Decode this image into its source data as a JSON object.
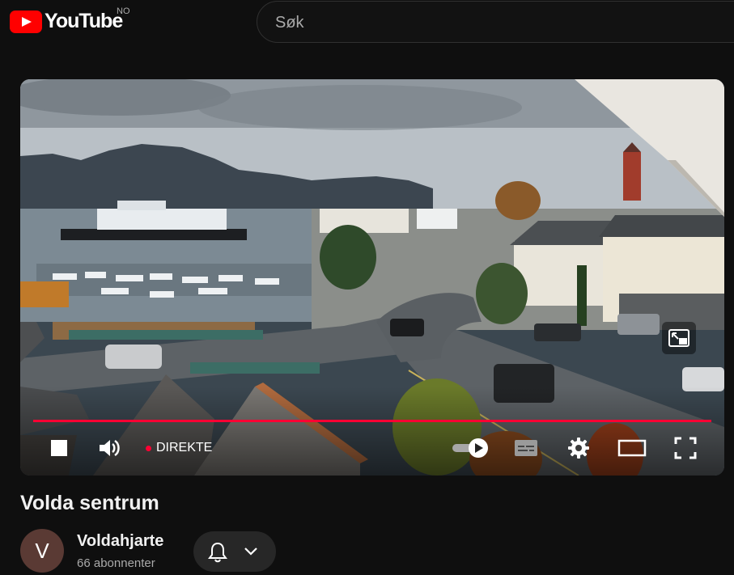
{
  "header": {
    "logo_text": "YouTube",
    "region": "NO",
    "search_placeholder": "Søk"
  },
  "player": {
    "live_label": "DIREKTE",
    "buttons": [
      "stop",
      "volume",
      "autoplay-toggle",
      "subtitles",
      "settings",
      "theater-mode",
      "fullscreen",
      "miniplayer"
    ]
  },
  "video": {
    "title": "Volda sentrum"
  },
  "channel": {
    "avatar_letter": "V",
    "name": "Voldahjarte",
    "subscribers": "66 abonnenter"
  },
  "colors": {
    "background": "#0f0f0f",
    "brand": "#ff0000",
    "progress": "#ff0033",
    "avatar": "#5a3a34"
  }
}
